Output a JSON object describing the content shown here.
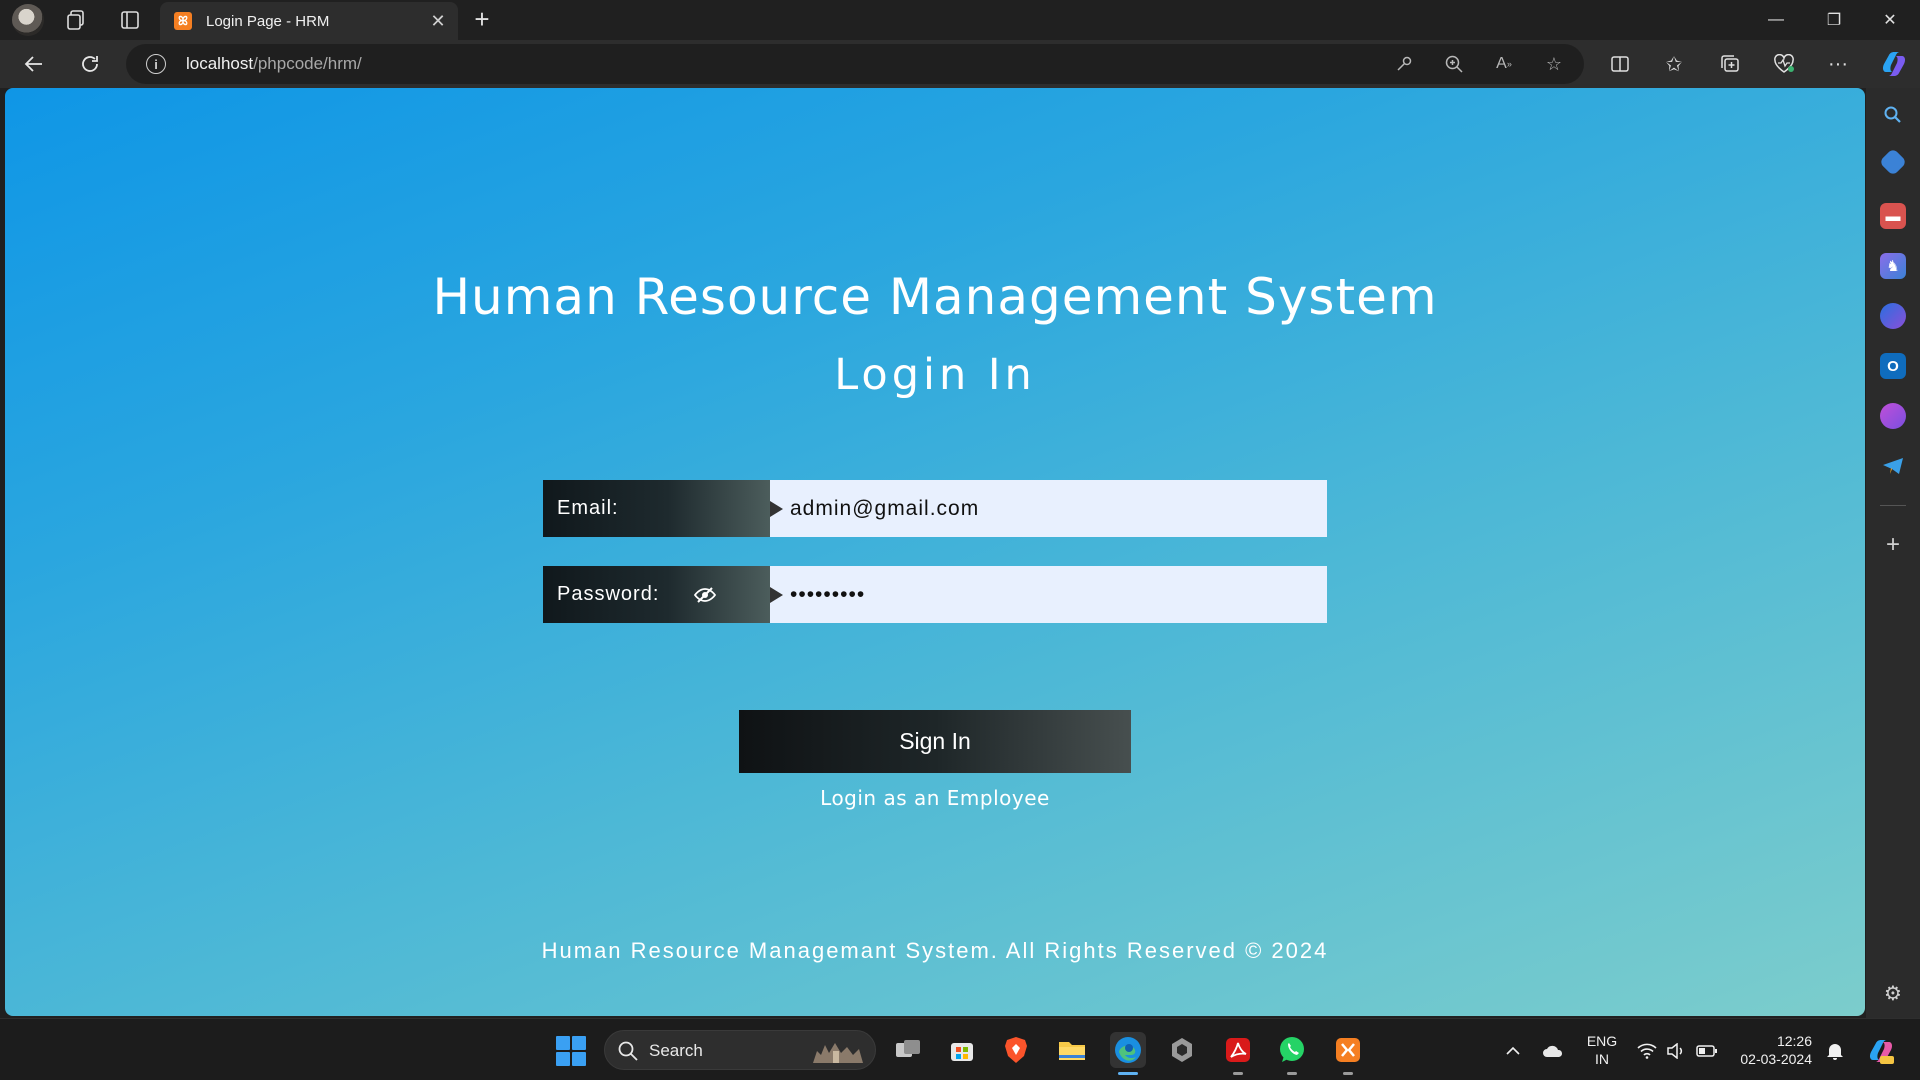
{
  "browser": {
    "tab": {
      "title": "Login Page - HRM",
      "favicon_text": "ꕤ"
    },
    "new_tab_label": "+",
    "window_controls": {
      "minimize": "—",
      "restore": "❐",
      "close": "✕"
    },
    "address": {
      "host": "localhost",
      "path": "/phpcode/hrm/"
    },
    "sidebar_icons": [
      "search-icon",
      "shopping-tag-icon",
      "tools-icon",
      "games-icon",
      "copilot-icon",
      "outlook-icon",
      "designer-icon",
      "telegram-icon",
      "add-icon",
      "settings-icon"
    ]
  },
  "page": {
    "title": "Human Resource Management System",
    "subtitle": "Login In",
    "email": {
      "label": "Email:",
      "value": "admin@gmail.com"
    },
    "password": {
      "label": "Password:",
      "value": "•••••••••"
    },
    "signin_label": "Sign In",
    "employee_link": "Login as an Employee",
    "footer": "Human Resource Managemant System. All Rights Reserved © 2024"
  },
  "taskbar": {
    "search_label": "Search",
    "apps": [
      "task-view",
      "microsoft-store",
      "brave",
      "file-explorer",
      "edge",
      "unity",
      "acrobat",
      "whatsapp",
      "xampp"
    ],
    "language": {
      "line1": "ENG",
      "line2": "IN"
    },
    "time": "12:26",
    "date": "02-03-2024"
  },
  "colors": {
    "page_gradient_start": "#0f96e6",
    "page_gradient_end": "#7ccdcc",
    "input_background": "#e8f0fe",
    "button_dark": "#1e2628"
  }
}
